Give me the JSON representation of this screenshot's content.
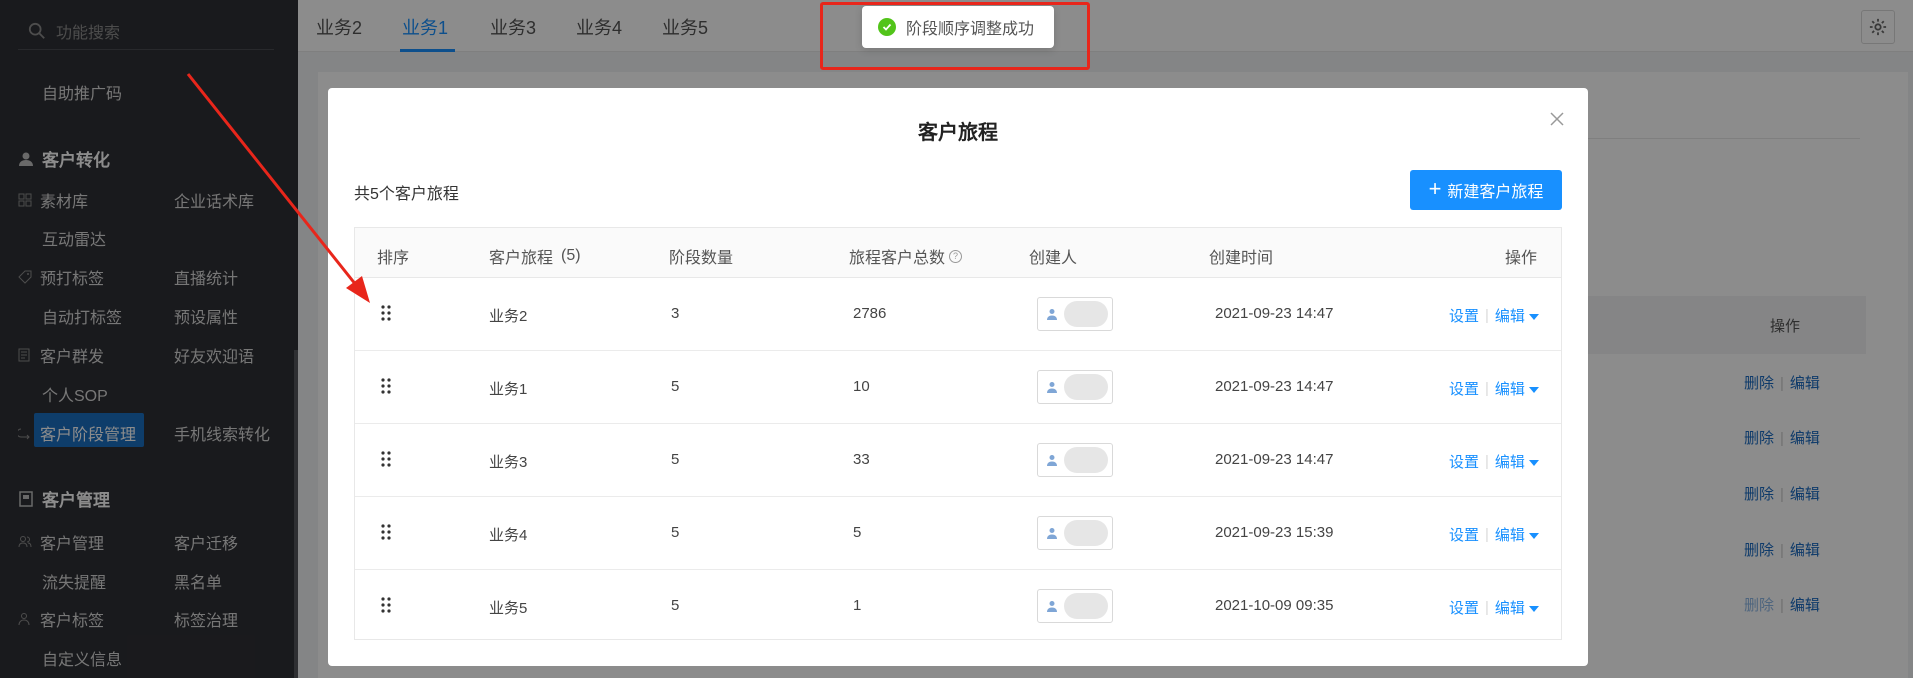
{
  "sidebar": {
    "search_placeholder": "功能搜索",
    "items_top": {
      "promo_code": "自助推广码"
    },
    "section_conversion": "客户转化",
    "conversion_items": {
      "material_lib": "素材库",
      "enterprise_script": "企业话术库",
      "interaction_radar": "互动雷达",
      "pre_tag": "预打标签",
      "live_stats": "直播统计",
      "auto_tag": "自动打标签",
      "preset_attr": "预设属性",
      "mass_send": "客户群发",
      "friend_welcome": "好友欢迎语",
      "personal_sop": "个人SOP",
      "stage_mgmt": "客户阶段管理",
      "phone_lead": "手机线索转化"
    },
    "section_management": "客户管理",
    "management_items": {
      "customer_mgmt": "客户管理",
      "customer_transfer": "客户迁移",
      "churn_alert": "流失提醒",
      "blacklist": "黑名单",
      "customer_tag": "客户标签",
      "tag_governance": "标签治理",
      "custom_info": "自定义信息"
    }
  },
  "tabs": [
    "业务2",
    "业务1",
    "业务3",
    "业务4",
    "业务5"
  ],
  "active_tab_index": 1,
  "toast": {
    "message": "阶段顺序调整成功",
    "type": "success"
  },
  "background": {
    "op_header": "操作",
    "row_delete": "删除",
    "row_edit": "编辑"
  },
  "modal": {
    "title": "客户旅程",
    "count_text": "共5个客户旅程",
    "new_button": "新建客户旅程",
    "columns": {
      "sort": "排序",
      "journey": "客户旅程",
      "journey_count": "(5)",
      "stage_count": "阶段数量",
      "total_customers": "旅程客户总数",
      "creator": "创建人",
      "created_at": "创建时间",
      "actions": "操作"
    },
    "rows": [
      {
        "name": "业务2",
        "stages": "3",
        "customers": "2786",
        "created": "2021-09-23 14:47"
      },
      {
        "name": "业务1",
        "stages": "5",
        "customers": "10",
        "created": "2021-09-23 14:47"
      },
      {
        "name": "业务3",
        "stages": "5",
        "customers": "33",
        "created": "2021-09-23 14:47"
      },
      {
        "name": "业务4",
        "stages": "5",
        "customers": "5",
        "created": "2021-09-23 15:39"
      },
      {
        "name": "业务5",
        "stages": "5",
        "customers": "1",
        "created": "2021-10-09 09:35"
      }
    ],
    "action_settings": "设置",
    "action_edit": "编辑"
  },
  "colors": {
    "accent": "#1890ff",
    "sidebar_bg": "#2f3035",
    "success": "#52c41a",
    "annotation": "#e8261b"
  }
}
